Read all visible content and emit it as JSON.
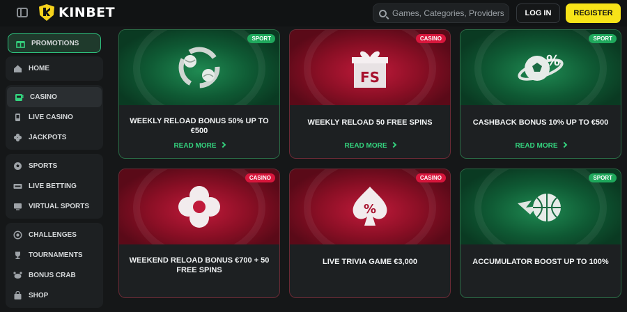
{
  "header": {
    "logo_text": "KINBET",
    "search_placeholder": "Games, Categories, Providers",
    "login_label": "LOG IN",
    "register_label": "REGISTER"
  },
  "sidebar": {
    "groups": [
      [
        {
          "label": "PROMOTIONS",
          "icon": "gift-icon"
        }
      ],
      [
        {
          "label": "HOME",
          "icon": "home-icon"
        }
      ],
      [
        {
          "label": "CASINO",
          "icon": "slot-machine-icon"
        },
        {
          "label": "LIVE CASINO",
          "icon": "phone-icon"
        },
        {
          "label": "JACKPOTS",
          "icon": "clover-icon"
        }
      ],
      [
        {
          "label": "SPORTS",
          "icon": "soccer-ball-icon"
        },
        {
          "label": "LIVE BETTING",
          "icon": "live-icon"
        },
        {
          "label": "VIRTUAL SPORTS",
          "icon": "monitor-icon"
        }
      ],
      [
        {
          "label": "CHALLENGES",
          "icon": "target-icon"
        },
        {
          "label": "TOURNAMENTS",
          "icon": "trophy-icon"
        },
        {
          "label": "BONUS CRAB",
          "icon": "crab-icon"
        },
        {
          "label": "SHOP",
          "icon": "bag-icon"
        }
      ]
    ]
  },
  "promotions": [
    {
      "badge": "SPORT",
      "title": "WEEKLY RELOAD BONUS 50% UP TO €500",
      "link": "READ MORE",
      "theme": "green",
      "art": "tennis-balls-icon"
    },
    {
      "badge": "CASINO",
      "title": "WEEKLY RELOAD 50 FREE SPINS",
      "link": "READ MORE",
      "theme": "red",
      "art": "gift-fs-icon"
    },
    {
      "badge": "SPORT",
      "title": "CASHBACK BONUS 10% UP TO €500",
      "link": "READ MORE",
      "theme": "green",
      "art": "soccer-percent-icon"
    },
    {
      "badge": "CASINO",
      "title": "WEEKEND RELOAD BONUS €700 + 50 FREE SPINS",
      "link": "",
      "theme": "red",
      "art": "clover-icon"
    },
    {
      "badge": "CASINO",
      "title": "LIVE TRIVIA GAME €3,000",
      "link": "",
      "theme": "red",
      "art": "spade-percent-icon"
    },
    {
      "badge": "SPORT",
      "title": "ACCUMULATOR BOOST UP TO 100%",
      "link": "",
      "theme": "green",
      "art": "basketball-icon"
    }
  ]
}
